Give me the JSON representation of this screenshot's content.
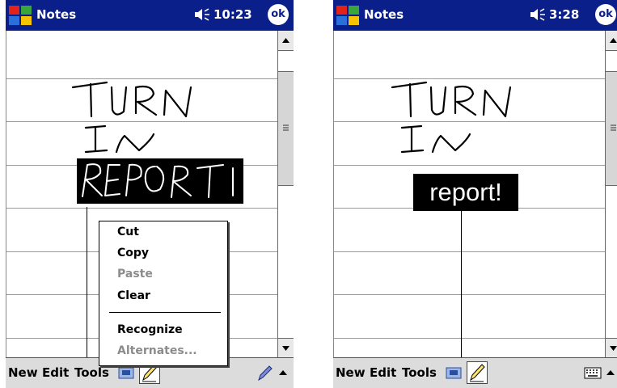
{
  "colors": {
    "titlebar": "#0a1f8a",
    "menubar": "#dcdcdc",
    "disabled": "#8c8c8c"
  },
  "left_screen": {
    "title": "Notes",
    "time": "10:23",
    "ok": "ok",
    "context_menu": {
      "items": [
        {
          "label": "Cut",
          "enabled": true
        },
        {
          "label": "Copy",
          "enabled": true
        },
        {
          "label": "Paste",
          "enabled": false
        },
        {
          "label": "Clear",
          "enabled": true
        },
        {
          "label": "Recognize",
          "enabled": true
        },
        {
          "label": "Alternates...",
          "enabled": false
        }
      ]
    },
    "menubar": {
      "new": "New",
      "edit": "Edit",
      "tools": "Tools"
    }
  },
  "right_screen": {
    "title": "Notes",
    "time": "3:28",
    "ok": "ok",
    "recognized_text": "report!",
    "menubar": {
      "new": "New",
      "edit": "Edit",
      "tools": "Tools"
    }
  },
  "icons": [
    "windows-start-icon",
    "speaker-icon",
    "ok-button",
    "keyboard-icon",
    "pen-icon",
    "scroll-up-icon",
    "scroll-down-icon",
    "input-panel-arrow-icon"
  ]
}
